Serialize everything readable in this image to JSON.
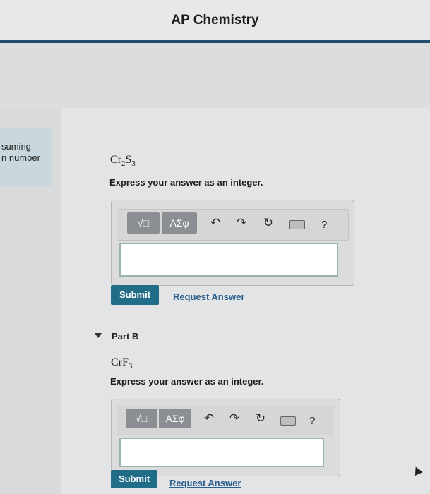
{
  "header": {
    "title": "AP Chemistry"
  },
  "side_panel": {
    "line1": "suming",
    "line2": "n number"
  },
  "part_a": {
    "formula": {
      "el1": "Cr",
      "sub1": "2",
      "el2": "S",
      "sub2": "3"
    },
    "instruction": "Express your answer as an integer.",
    "toolbar": {
      "template_label": "√□",
      "symbols_label": "ΑΣφ",
      "help_label": "?"
    },
    "input_value": "",
    "submit_label": "Submit",
    "request_label": "Request Answer"
  },
  "part_b": {
    "label": "Part B",
    "formula": {
      "el1": "CrF",
      "sub1": "3"
    },
    "instruction": "Express your answer as an integer.",
    "toolbar": {
      "template_label": "√□",
      "symbols_label": "ΑΣφ",
      "help_label": "?"
    },
    "input_value": "",
    "submit_label": "Submit",
    "request_label": "Request Answer"
  },
  "colors": {
    "header_rule": "#1f4f6b",
    "submit": "#216c86",
    "link": "#2a5f8f"
  }
}
